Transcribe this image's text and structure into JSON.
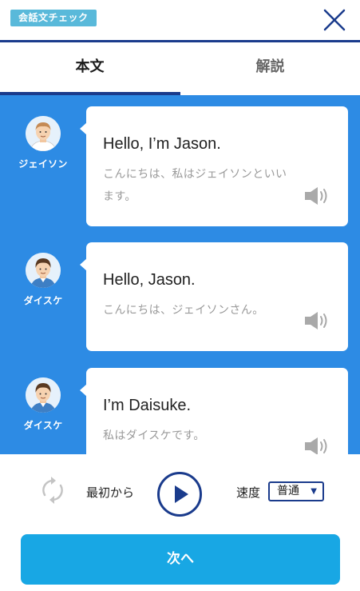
{
  "header": {
    "badge": "会話文チェック",
    "close_icon": "close-icon"
  },
  "tabs": [
    {
      "label": "本文",
      "active": true
    },
    {
      "label": "解説",
      "active": false
    }
  ],
  "messages": [
    {
      "speaker": "ジェイソン",
      "en": "Hello, I’m Jason.",
      "ja": "こんにちは、私はジェイソンといいます。"
    },
    {
      "speaker": "ダイスケ",
      "en": "Hello, Jason.",
      "ja": "こんにちは、ジェイソンさん。"
    },
    {
      "speaker": "ダイスケ",
      "en": "I’m Daisuke.",
      "ja": "私はダイスケです。"
    }
  ],
  "controls": {
    "from_start": "最初から",
    "speed_label": "速度",
    "speed_value": "普通"
  },
  "next_button": "次へ",
  "colors": {
    "navy": "#1a3b8c",
    "chat_bg": "#2d8be4",
    "badge": "#59b9da",
    "next": "#18a7e4"
  }
}
